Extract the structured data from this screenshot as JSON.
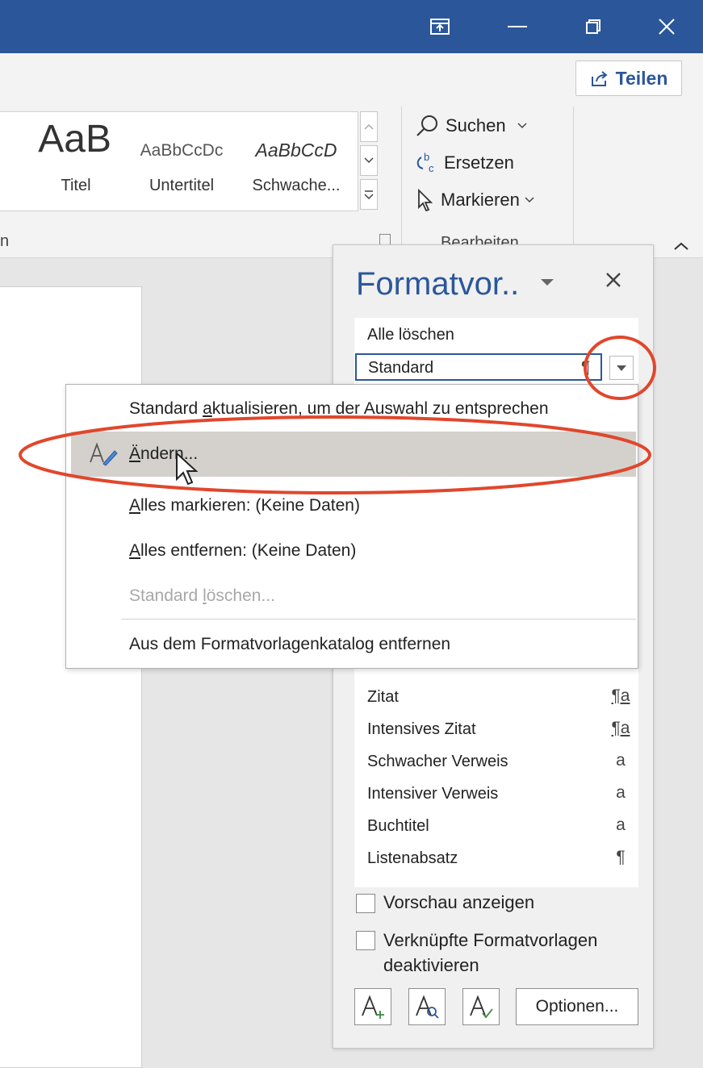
{
  "window": {
    "share_label": "Teilen",
    "collapse_ribbon_icon": "chevron-up-icon"
  },
  "ribbon": {
    "styles": [
      {
        "preview": "AaB",
        "label": "Titel"
      },
      {
        "preview": "AaBbCcDc",
        "label": "Untertitel"
      },
      {
        "preview": "AaBbCcD",
        "label": "Schwache..."
      }
    ],
    "styles_group_label_fragment": "n",
    "edit_group": {
      "search_label": "Suchen",
      "replace_label": "Ersetzen",
      "select_label": "Markieren",
      "group_label": "Bearbeiten"
    }
  },
  "styles_pane": {
    "title": "Formatvor..",
    "list": [
      {
        "name": "Alle löschen",
        "symbol": ""
      },
      {
        "name": "Standard",
        "symbol": "¶"
      },
      {
        "name": "Zitat",
        "symbol": "¶a"
      },
      {
        "name": "Intensives Zitat",
        "symbol": "¶a"
      },
      {
        "name": "Schwacher Verweis",
        "symbol": "a"
      },
      {
        "name": "Intensiver Verweis",
        "symbol": "a"
      },
      {
        "name": "Buchtitel",
        "symbol": "a"
      },
      {
        "name": "Listenabsatz",
        "symbol": "¶"
      }
    ],
    "show_preview_label": "Vorschau anzeigen",
    "disable_linked_label_1": "Verknüpfte Formatvorlagen",
    "disable_linked_label_2": "deaktivieren",
    "options_label": "Optionen..."
  },
  "context_menu": {
    "items": [
      {
        "pre": "Standard ",
        "key": "a",
        "post": "ktualisieren, um der Auswahl zu entsprechen",
        "state": "normal"
      },
      {
        "pre": "",
        "key": "Ä",
        "post": "ndern...",
        "state": "hover"
      },
      {
        "pre": "",
        "key": "A",
        "post": "lles markieren: (Keine Daten)",
        "state": "normal"
      },
      {
        "pre": "",
        "key": "A",
        "post": "lles entfernen: (Keine Daten)",
        "state": "normal"
      },
      {
        "pre": "Standard ",
        "key": "l",
        "post": "öschen...",
        "state": "disabled"
      },
      {
        "pre": "Aus dem Formatvorla",
        "key": "g",
        "post": "enkatalog entfernen",
        "state": "normal"
      }
    ]
  },
  "colors": {
    "accent": "#2b579a",
    "annotation": "#e0472c",
    "hover": "#d4d1cc"
  }
}
